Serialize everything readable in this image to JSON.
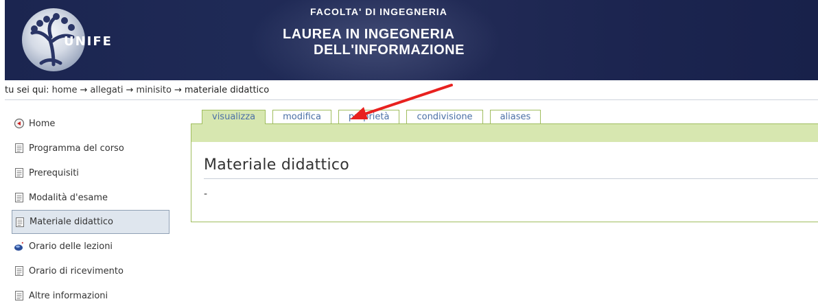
{
  "header": {
    "logo_text": "UNIFE",
    "faculty": "FACOLTA' DI INGEGNERIA",
    "degree_line1": "LAUREA IN INGEGNERIA",
    "degree_line2": "DELL'INFORMAZIONE"
  },
  "breadcrumb": {
    "prefix": "tu sei qui:",
    "items": [
      "home",
      "allegati",
      "minisito",
      "materiale didattico"
    ],
    "separator": "→"
  },
  "sidebar": {
    "items": [
      {
        "label": "Home",
        "icon": "home-icon"
      },
      {
        "label": "Programma del corso",
        "icon": "document-icon"
      },
      {
        "label": "Prerequisiti",
        "icon": "document-icon"
      },
      {
        "label": "Modalità d'esame",
        "icon": "document-icon"
      },
      {
        "label": "Materiale didattico",
        "icon": "document-icon",
        "active": true
      },
      {
        "label": "Orario delle lezioni",
        "icon": "event-icon"
      },
      {
        "label": "Orario di ricevimento",
        "icon": "document-icon"
      },
      {
        "label": "Altre informazioni",
        "icon": "document-icon"
      }
    ]
  },
  "tabs": [
    {
      "label": "visualizza",
      "active": true
    },
    {
      "label": "modifica"
    },
    {
      "label": "proprietà"
    },
    {
      "label": "condivisione"
    },
    {
      "label": "aliases"
    }
  ],
  "main": {
    "title": "Materiale didattico",
    "body": "-"
  },
  "colors": {
    "banner": "#1f2a56",
    "tab_green": "#d7e7b0",
    "tab_border": "#9fbd5d",
    "tab_text": "#4a6fa6",
    "arrow": "#e8211f"
  }
}
